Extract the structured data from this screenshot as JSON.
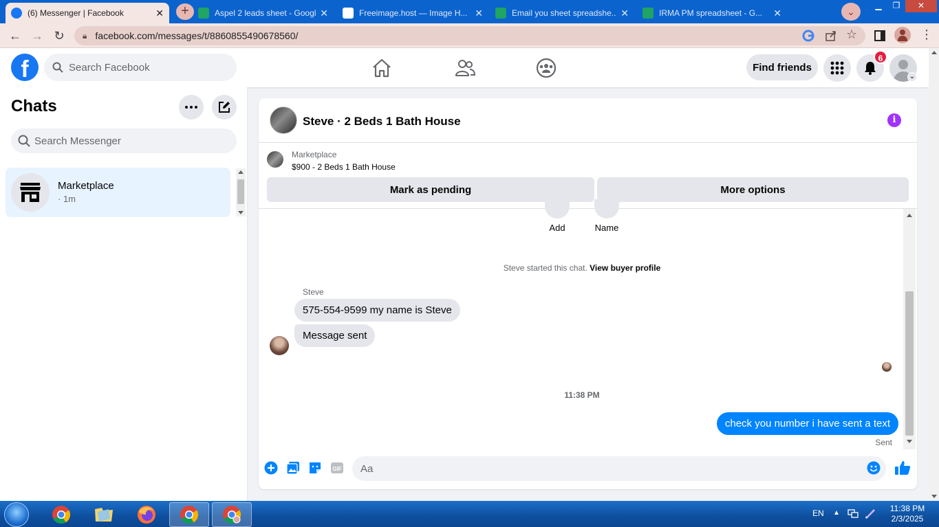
{
  "browser": {
    "tabs": [
      {
        "title": "(6) Messenger | Facebook",
        "favicon_color": "#1877f2"
      },
      {
        "title": "Aspel 2 leads sheet - Googl...",
        "favicon_color": "#1fa463"
      },
      {
        "title": "Freeimage.host — Image H...",
        "favicon_color": "#ffffff"
      },
      {
        "title": "Email you sheet spreadshe...",
        "favicon_color": "#1fa463"
      },
      {
        "title": "IRMA PM spreadsheet - G...",
        "favicon_color": "#1fa463"
      }
    ],
    "url": "facebook.com/messages/t/8860855490678560/"
  },
  "fb": {
    "search_placeholder": "Search Facebook",
    "find_friends": "Find friends",
    "notification_count": "6",
    "brand_color": "#1877f2"
  },
  "sidebar": {
    "title": "Chats",
    "search_placeholder": "Search Messenger",
    "chats": [
      {
        "name": "Marketplace",
        "time": "· 1m"
      }
    ]
  },
  "conversation": {
    "header_title": "Steve · 2 Beds 1 Bath House",
    "marketplace_label": "Marketplace",
    "listing": "$900 - 2 Beds 1 Bath House",
    "mark_pending": "Mark as pending",
    "more_options": "More options",
    "actions": [
      {
        "label": "Add"
      },
      {
        "label": "Name"
      }
    ],
    "started_text": "Steve started this chat.",
    "view_profile": "View buyer profile",
    "sender_name": "Steve",
    "incoming": [
      "575-554-9599 my name is Steve",
      "Message sent"
    ],
    "timestamp": "11:38 PM",
    "outgoing": "check you number i have sent a text",
    "status": "Sent",
    "composer_placeholder": "Aa"
  },
  "taskbar": {
    "lang": "EN",
    "time": "11:38 PM",
    "date": "2/3/2025"
  }
}
